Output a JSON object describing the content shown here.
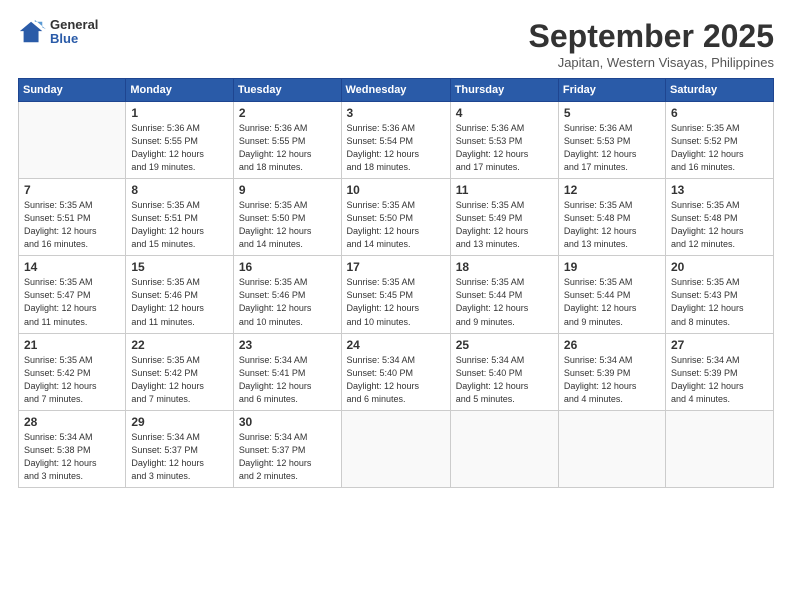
{
  "logo": {
    "general": "General",
    "blue": "Blue"
  },
  "title": "September 2025",
  "location": "Japitan, Western Visayas, Philippines",
  "days_of_week": [
    "Sunday",
    "Monday",
    "Tuesday",
    "Wednesday",
    "Thursday",
    "Friday",
    "Saturday"
  ],
  "weeks": [
    [
      {
        "day": "",
        "info": ""
      },
      {
        "day": "1",
        "info": "Sunrise: 5:36 AM\nSunset: 5:55 PM\nDaylight: 12 hours\nand 19 minutes."
      },
      {
        "day": "2",
        "info": "Sunrise: 5:36 AM\nSunset: 5:55 PM\nDaylight: 12 hours\nand 18 minutes."
      },
      {
        "day": "3",
        "info": "Sunrise: 5:36 AM\nSunset: 5:54 PM\nDaylight: 12 hours\nand 18 minutes."
      },
      {
        "day": "4",
        "info": "Sunrise: 5:36 AM\nSunset: 5:53 PM\nDaylight: 12 hours\nand 17 minutes."
      },
      {
        "day": "5",
        "info": "Sunrise: 5:36 AM\nSunset: 5:53 PM\nDaylight: 12 hours\nand 17 minutes."
      },
      {
        "day": "6",
        "info": "Sunrise: 5:35 AM\nSunset: 5:52 PM\nDaylight: 12 hours\nand 16 minutes."
      }
    ],
    [
      {
        "day": "7",
        "info": "Sunrise: 5:35 AM\nSunset: 5:51 PM\nDaylight: 12 hours\nand 16 minutes."
      },
      {
        "day": "8",
        "info": "Sunrise: 5:35 AM\nSunset: 5:51 PM\nDaylight: 12 hours\nand 15 minutes."
      },
      {
        "day": "9",
        "info": "Sunrise: 5:35 AM\nSunset: 5:50 PM\nDaylight: 12 hours\nand 14 minutes."
      },
      {
        "day": "10",
        "info": "Sunrise: 5:35 AM\nSunset: 5:50 PM\nDaylight: 12 hours\nand 14 minutes."
      },
      {
        "day": "11",
        "info": "Sunrise: 5:35 AM\nSunset: 5:49 PM\nDaylight: 12 hours\nand 13 minutes."
      },
      {
        "day": "12",
        "info": "Sunrise: 5:35 AM\nSunset: 5:48 PM\nDaylight: 12 hours\nand 13 minutes."
      },
      {
        "day": "13",
        "info": "Sunrise: 5:35 AM\nSunset: 5:48 PM\nDaylight: 12 hours\nand 12 minutes."
      }
    ],
    [
      {
        "day": "14",
        "info": "Sunrise: 5:35 AM\nSunset: 5:47 PM\nDaylight: 12 hours\nand 11 minutes."
      },
      {
        "day": "15",
        "info": "Sunrise: 5:35 AM\nSunset: 5:46 PM\nDaylight: 12 hours\nand 11 minutes."
      },
      {
        "day": "16",
        "info": "Sunrise: 5:35 AM\nSunset: 5:46 PM\nDaylight: 12 hours\nand 10 minutes."
      },
      {
        "day": "17",
        "info": "Sunrise: 5:35 AM\nSunset: 5:45 PM\nDaylight: 12 hours\nand 10 minutes."
      },
      {
        "day": "18",
        "info": "Sunrise: 5:35 AM\nSunset: 5:44 PM\nDaylight: 12 hours\nand 9 minutes."
      },
      {
        "day": "19",
        "info": "Sunrise: 5:35 AM\nSunset: 5:44 PM\nDaylight: 12 hours\nand 9 minutes."
      },
      {
        "day": "20",
        "info": "Sunrise: 5:35 AM\nSunset: 5:43 PM\nDaylight: 12 hours\nand 8 minutes."
      }
    ],
    [
      {
        "day": "21",
        "info": "Sunrise: 5:35 AM\nSunset: 5:42 PM\nDaylight: 12 hours\nand 7 minutes."
      },
      {
        "day": "22",
        "info": "Sunrise: 5:35 AM\nSunset: 5:42 PM\nDaylight: 12 hours\nand 7 minutes."
      },
      {
        "day": "23",
        "info": "Sunrise: 5:34 AM\nSunset: 5:41 PM\nDaylight: 12 hours\nand 6 minutes."
      },
      {
        "day": "24",
        "info": "Sunrise: 5:34 AM\nSunset: 5:40 PM\nDaylight: 12 hours\nand 6 minutes."
      },
      {
        "day": "25",
        "info": "Sunrise: 5:34 AM\nSunset: 5:40 PM\nDaylight: 12 hours\nand 5 minutes."
      },
      {
        "day": "26",
        "info": "Sunrise: 5:34 AM\nSunset: 5:39 PM\nDaylight: 12 hours\nand 4 minutes."
      },
      {
        "day": "27",
        "info": "Sunrise: 5:34 AM\nSunset: 5:39 PM\nDaylight: 12 hours\nand 4 minutes."
      }
    ],
    [
      {
        "day": "28",
        "info": "Sunrise: 5:34 AM\nSunset: 5:38 PM\nDaylight: 12 hours\nand 3 minutes."
      },
      {
        "day": "29",
        "info": "Sunrise: 5:34 AM\nSunset: 5:37 PM\nDaylight: 12 hours\nand 3 minutes."
      },
      {
        "day": "30",
        "info": "Sunrise: 5:34 AM\nSunset: 5:37 PM\nDaylight: 12 hours\nand 2 minutes."
      },
      {
        "day": "",
        "info": ""
      },
      {
        "day": "",
        "info": ""
      },
      {
        "day": "",
        "info": ""
      },
      {
        "day": "",
        "info": ""
      }
    ]
  ]
}
